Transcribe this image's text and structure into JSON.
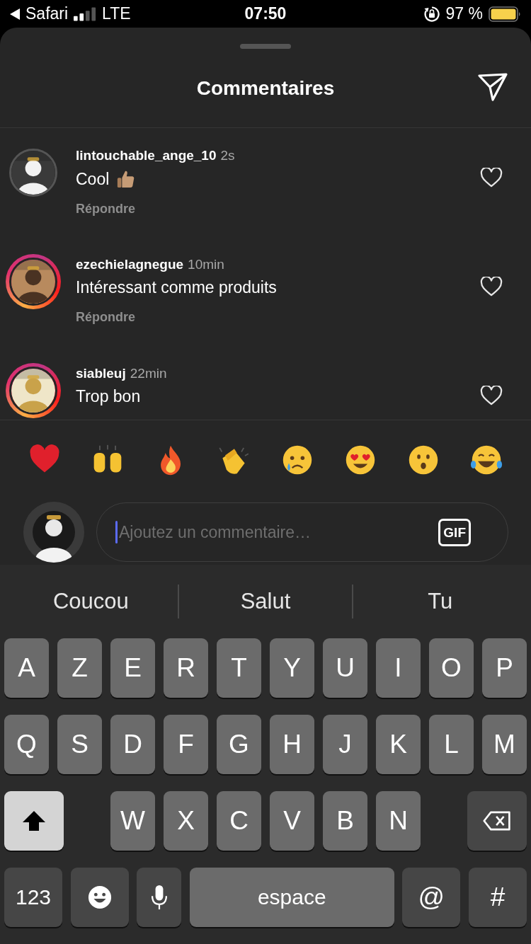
{
  "status_bar": {
    "back_app": "Safari",
    "network": "LTE",
    "time": "07:50",
    "battery": "97 %"
  },
  "sheet": {
    "title": "Commentaires"
  },
  "comments": [
    {
      "username": "lintouchable_ange_10",
      "time": "2s",
      "text": "Cool",
      "reply": "Répondre",
      "story_ring": false,
      "liked": false
    },
    {
      "username": "ezechielagnegue",
      "time": "10min",
      "text": "Intéressant comme produits",
      "reply": "Répondre",
      "story_ring": true,
      "liked": false
    },
    {
      "username": "siableuj",
      "time": "22min",
      "text": "Trop bon",
      "story_ring": true,
      "liked": false
    }
  ],
  "composer": {
    "placeholder": "Ajoutez un commentaire…",
    "gif": "GIF"
  },
  "keyboard": {
    "suggestions": [
      "Coucou",
      "Salut",
      "Tu"
    ],
    "top_letters": [
      "A",
      "Z",
      "E",
      "R",
      "T",
      "Y",
      "U",
      "I",
      "O",
      "P"
    ],
    "middle_letters": [
      "Q",
      "S",
      "D",
      "F",
      "G",
      "H",
      "J",
      "K",
      "L",
      "M"
    ],
    "bottom_letters": [
      "W",
      "X",
      "C",
      "V",
      "B",
      "N"
    ],
    "numbers": "123",
    "space": "espace",
    "at": "@",
    "hash": "#"
  }
}
